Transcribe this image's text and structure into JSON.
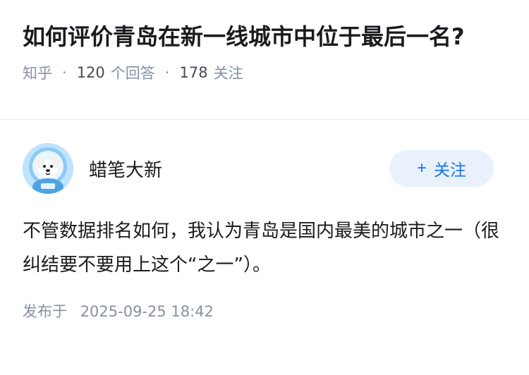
{
  "question": {
    "title": "如何评价青岛在新一线城市中位于最后一名?",
    "source": "知乎",
    "answers_count": "120",
    "answers_label": "个回答",
    "followers_count": "178",
    "followers_label": "关注"
  },
  "answer": {
    "author": {
      "name": "蜡笔大新",
      "avatar": "astronaut-dog-avatar-icon"
    },
    "follow_button": {
      "plus": "+",
      "label": "关注"
    },
    "content": "不管数据排名如何，我认为青岛是国内最美的城市之一（很纠结要不要用上这个“之一”）。",
    "published_label": "发布于",
    "published_time": "2025-09-25 18:42"
  },
  "colors": {
    "accent": "#1772f6",
    "follow_bg": "#e8f1fc",
    "meta": "#8590a6",
    "text": "#191b1f"
  }
}
